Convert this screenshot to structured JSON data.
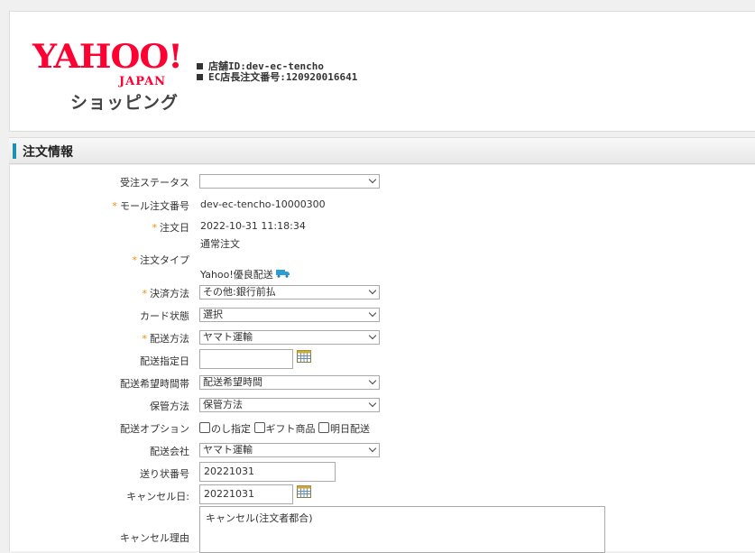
{
  "header": {
    "logo": {
      "yahoo": "YAHOO!",
      "japan": "JAPAN",
      "shopping": "ショッピング"
    },
    "store_id": "店舗ID:dev-ec-tencho",
    "order_number": "EC店長注文番号:120920016641"
  },
  "section": {
    "title": "注文情報"
  },
  "form": {
    "order_status": {
      "label": "受注ステータス",
      "value": ""
    },
    "mall_order_no": {
      "label": "モール注文番号",
      "value": "dev-ec-tencho-10000300"
    },
    "order_date": {
      "label": "注文日",
      "value": "2022-10-31 11:18:34"
    },
    "order_type": {
      "label": "注文タイプ",
      "line1": "通常注文",
      "line2": "Yahoo!優良配送"
    },
    "payment": {
      "label": "決済方法",
      "value": "その他:銀行前払"
    },
    "card_status": {
      "label": "カード状態",
      "value": "選択"
    },
    "ship_method": {
      "label": "配送方法",
      "value": "ヤマト運輸"
    },
    "ship_date": {
      "label": "配送指定日",
      "value": ""
    },
    "ship_time": {
      "label": "配送希望時間帯",
      "value": "配送希望時間"
    },
    "storage": {
      "label": "保管方法",
      "value": "保管方法"
    },
    "ship_options": {
      "label": "配送オプション",
      "noshi": "のし指定",
      "gift": "ギフト商品",
      "nextday": "明日配送"
    },
    "ship_company": {
      "label": "配送会社",
      "value": "ヤマト運輸"
    },
    "tracking_no": {
      "label": "送り状番号",
      "value": "20221031"
    },
    "cancel_date": {
      "label": "キャンセル日:",
      "value": "20221031"
    },
    "cancel_reason": {
      "label": "キャンセル理由",
      "value": "キャンセル(注文者都合)"
    }
  },
  "required_mark": "*"
}
